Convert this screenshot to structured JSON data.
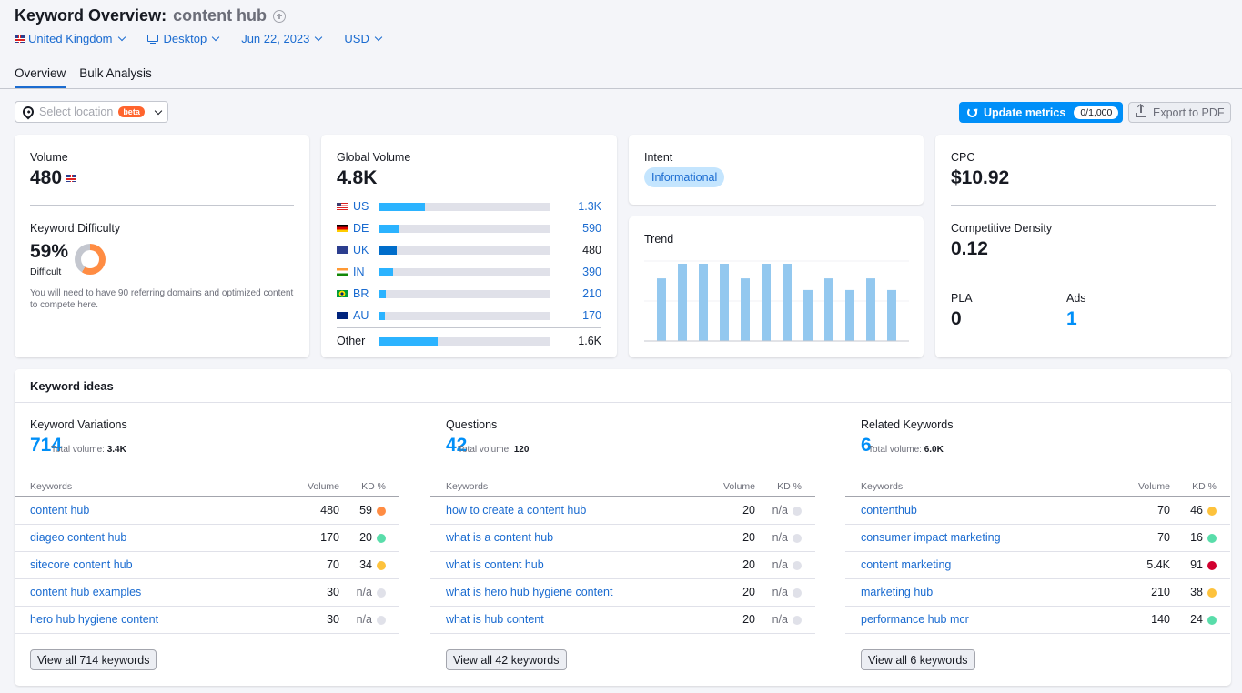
{
  "header": {
    "title_prefix": "Keyword Overview:",
    "keyword": "content hub",
    "filters": {
      "country": "United Kingdom",
      "device": "Desktop",
      "date": "Jun 22, 2023",
      "currency": "USD"
    },
    "tabs": [
      {
        "label": "Overview",
        "active": true
      },
      {
        "label": "Bulk Analysis",
        "active": false
      }
    ]
  },
  "toolbar": {
    "location_placeholder": "Select location",
    "location_badge": "beta",
    "update_label": "Update metrics",
    "update_quota": "0/1,000",
    "export_label": "Export to PDF"
  },
  "volume": {
    "label": "Volume",
    "value": "480",
    "kd_label": "Keyword Difficulty",
    "kd_value": "59%",
    "kd_percent": 59,
    "kd_level": "Difficult",
    "kd_note": "You will need to have 90 referring domains and optimized content to compete here."
  },
  "global_volume": {
    "label": "Global Volume",
    "value": "4.8K",
    "countries": [
      {
        "code": "US",
        "value": "1.3K",
        "share": 0.27,
        "highlight": false
      },
      {
        "code": "DE",
        "value": "590",
        "share": 0.12,
        "highlight": false
      },
      {
        "code": "UK",
        "value": "480",
        "share": 0.1,
        "highlight": true
      },
      {
        "code": "IN",
        "value": "390",
        "share": 0.08,
        "highlight": false
      },
      {
        "code": "BR",
        "value": "210",
        "share": 0.04,
        "highlight": false
      },
      {
        "code": "AU",
        "value": "170",
        "share": 0.03,
        "highlight": false
      }
    ],
    "other": {
      "label": "Other",
      "value": "1.6K",
      "share": 0.34
    }
  },
  "intent": {
    "label": "Intent",
    "value": "Informational"
  },
  "trend": {
    "label": "Trend",
    "relative_values": [
      0.81,
      1.0,
      1.0,
      1.0,
      0.81,
      1.0,
      1.0,
      0.66,
      0.81,
      0.66,
      0.81,
      0.66
    ]
  },
  "cpc": {
    "label": "CPC",
    "value": "$10.92",
    "density_label": "Competitive Density",
    "density_value": "0.12",
    "pla_label": "PLA",
    "pla_value": "0",
    "ads_label": "Ads",
    "ads_value": "1"
  },
  "keyword_ideas": {
    "title": "Keyword ideas",
    "total_label": "Total volume:",
    "col_headers": {
      "keywords": "Keywords",
      "volume": "Volume",
      "kd": "KD %"
    },
    "kd_colors": {
      "orange": "#ff8c43",
      "green": "#59ddaa",
      "yellow": "#fdc23c",
      "red": "#d1002f",
      "grey": "#e0e1e9"
    },
    "columns": [
      {
        "title": "Keyword Variations",
        "count": "714",
        "total": "3.4K",
        "button": "View all 714 keywords",
        "rows": [
          {
            "keyword": "content hub",
            "volume": "480",
            "kd": "59",
            "color": "orange"
          },
          {
            "keyword": "diageo content hub",
            "volume": "170",
            "kd": "20",
            "color": "green"
          },
          {
            "keyword": "sitecore content hub",
            "volume": "70",
            "kd": "34",
            "color": "yellow"
          },
          {
            "keyword": "content hub examples",
            "volume": "30",
            "kd": "n/a",
            "color": "grey"
          },
          {
            "keyword": "hero hub hygiene content",
            "volume": "30",
            "kd": "n/a",
            "color": "grey"
          }
        ]
      },
      {
        "title": "Questions",
        "count": "42",
        "total": "120",
        "button": "View all 42 keywords",
        "rows": [
          {
            "keyword": "how to create a content hub",
            "volume": "20",
            "kd": "n/a",
            "color": "grey"
          },
          {
            "keyword": "what is a content hub",
            "volume": "20",
            "kd": "n/a",
            "color": "grey"
          },
          {
            "keyword": "what is content hub",
            "volume": "20",
            "kd": "n/a",
            "color": "grey"
          },
          {
            "keyword": "what is hero hub hygiene content",
            "volume": "20",
            "kd": "n/a",
            "color": "grey"
          },
          {
            "keyword": "what is hub content",
            "volume": "20",
            "kd": "n/a",
            "color": "grey"
          }
        ]
      },
      {
        "title": "Related Keywords",
        "count": "6",
        "total": "6.0K",
        "button": "View all 6 keywords",
        "rows": [
          {
            "keyword": "contenthub",
            "volume": "70",
            "kd": "46",
            "color": "yellow"
          },
          {
            "keyword": "consumer impact marketing",
            "volume": "70",
            "kd": "16",
            "color": "green"
          },
          {
            "keyword": "content marketing",
            "volume": "5.4K",
            "kd": "91",
            "color": "red"
          },
          {
            "keyword": "marketing hub",
            "volume": "210",
            "kd": "38",
            "color": "yellow"
          },
          {
            "keyword": "performance hub mcr",
            "volume": "140",
            "kd": "24",
            "color": "green"
          }
        ]
      }
    ]
  }
}
